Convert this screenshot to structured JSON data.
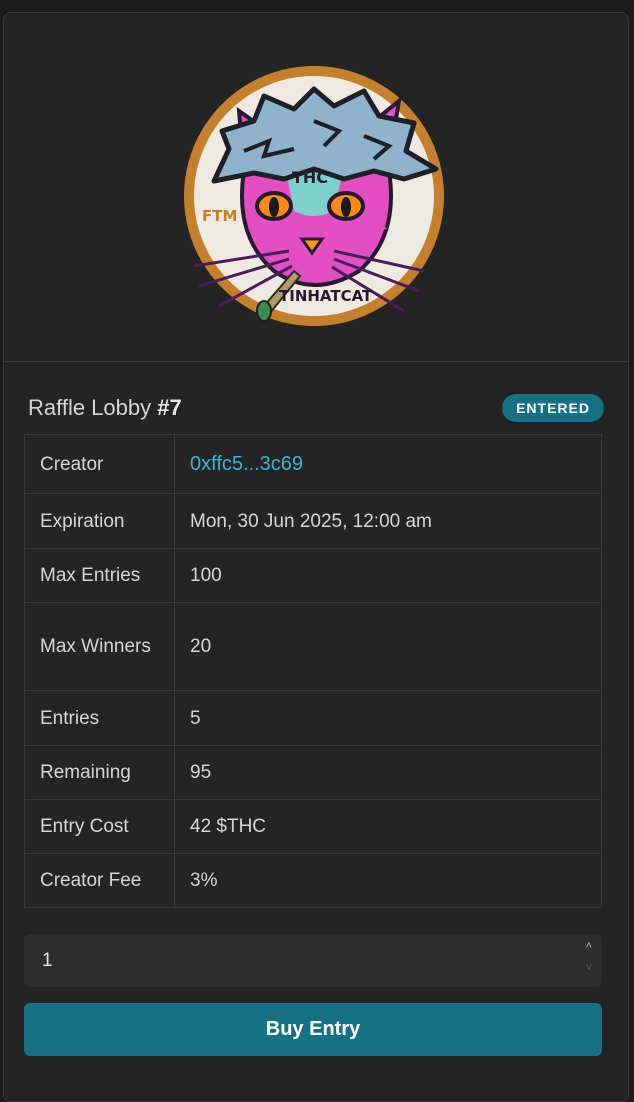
{
  "lobby": {
    "title_prefix": "Raffle Lobby",
    "number": "#7",
    "status": "ENTERED"
  },
  "image": {
    "ring_text_left": "FTM",
    "ring_text_bottom": "TINHATCAT",
    "forehead_text": "THC"
  },
  "details": [
    {
      "label": "Creator",
      "value": "0xffc5...3c69"
    },
    {
      "label": "Expiration",
      "value": "Mon, 30 Jun 2025, 12:00 am"
    },
    {
      "label": "Max Entries",
      "value": "100"
    },
    {
      "label": "Max Winners",
      "value": "20"
    },
    {
      "label": "Entries",
      "value": "5"
    },
    {
      "label": "Remaining",
      "value": "95"
    },
    {
      "label": "Entry Cost",
      "value": "42 $THC"
    },
    {
      "label": "Creator Fee",
      "value": "3%"
    }
  ],
  "quantity": {
    "value": "1"
  },
  "buy_button": {
    "label": "Buy Entry"
  },
  "colors": {
    "accent": "#167184",
    "link": "#3bb5cf",
    "card": "#242424"
  }
}
